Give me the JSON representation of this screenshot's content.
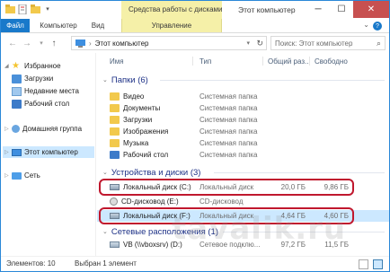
{
  "window": {
    "title": "Этот компьютер",
    "context_tab_group": "Средства работы с дисками",
    "controls": {
      "minimize": "─",
      "maximize": "☐",
      "close": "✕"
    }
  },
  "ribbon": {
    "tabs": [
      "Файл",
      "Компьютер",
      "Вид"
    ],
    "context_tab": "Управление",
    "help": "?"
  },
  "address": {
    "breadcrumb": "Этот компьютер",
    "search_placeholder": "Поиск: Этот компьютер"
  },
  "nav": {
    "favorites": "Избранное",
    "downloads": "Загрузки",
    "recent": "Недавние места",
    "desktop": "Рабочий стол",
    "homegroup": "Домашняя группа",
    "this_pc": "Этот компьютер",
    "network": "Сеть"
  },
  "columns": {
    "name": "Имя",
    "type": "Тип",
    "total": "Общий раз...",
    "free": "Свободно"
  },
  "groups": {
    "folders": "Папки (6)",
    "devices": "Устройства и диски (3)",
    "network": "Сетевые расположения (1)"
  },
  "folders": [
    {
      "name": "Видео",
      "type": "Системная папка"
    },
    {
      "name": "Документы",
      "type": "Системная папка"
    },
    {
      "name": "Загрузки",
      "type": "Системная папка"
    },
    {
      "name": "Изображения",
      "type": "Системная папка"
    },
    {
      "name": "Музыка",
      "type": "Системная папка"
    },
    {
      "name": "Рабочий стол",
      "type": "Системная папка"
    }
  ],
  "devices": [
    {
      "name": "Локальный диск (C:)",
      "type": "Локальный диск",
      "total": "20,0 ГБ",
      "free": "9,86 ГБ"
    },
    {
      "name": "CD-дисковод (E:)",
      "type": "CD-дисковод",
      "total": "",
      "free": ""
    },
    {
      "name": "Локальный диск (F:)",
      "type": "Локальный диск",
      "total": "4,64 ГБ",
      "free": "4,60 ГБ"
    }
  ],
  "network_locations": [
    {
      "name": "VB (\\\\vboxsrv) (D:)",
      "type": "Сетевое подклю...",
      "total": "97,2 ГБ",
      "free": "11,5 ГБ"
    }
  ],
  "status": {
    "items": "Элементов: 10",
    "selected": "Выбран 1 элемент"
  },
  "watermark": "tavalik.ru",
  "colors": {
    "accent": "#1979ca",
    "context": "#f5f0a8",
    "selection": "#cce8ff",
    "highlight": "#c0182e",
    "group_header": "#1e3287"
  }
}
